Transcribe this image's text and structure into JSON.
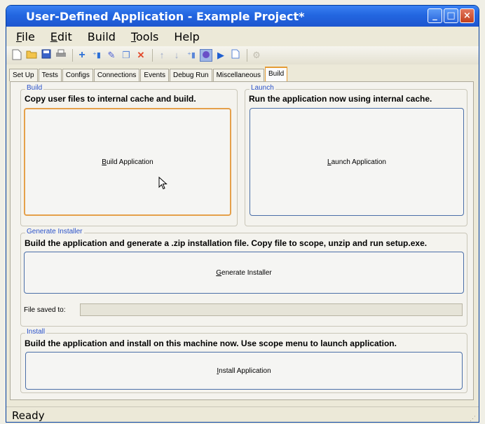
{
  "window": {
    "title": "User-Defined Application - Example Project*"
  },
  "menu": [
    {
      "label": "File",
      "accel": "F"
    },
    {
      "label": "Edit",
      "accel": "E"
    },
    {
      "label": "Build"
    },
    {
      "label": "Tools",
      "accel": "T"
    },
    {
      "label": "Help"
    }
  ],
  "toolbar": [
    "new-icon",
    "open-icon",
    "save-icon",
    "print-icon",
    "add-icon",
    "add-node-icon",
    "edit-icon",
    "copy-icon",
    "delete-icon",
    "move-up-icon",
    "move-down-icon",
    "indent-icon",
    "build-icon",
    "run-icon",
    "page-icon",
    "settings-icon"
  ],
  "tabs": [
    "Set Up",
    "Tests",
    "Configs",
    "Connections",
    "Events",
    "Debug Run",
    "Miscellaneous",
    "Build"
  ],
  "active_tab": "Build",
  "build": {
    "legend": "Build",
    "description": "Copy user files to internal cache and build.",
    "button": "Build Application"
  },
  "launch": {
    "legend": "Launch",
    "description": "Run the application now using internal cache.",
    "button": "Launch Application"
  },
  "installer": {
    "legend": "Generate Installer",
    "description": "Build the application and generate a .zip installation file. Copy file to scope, unzip and run setup.exe.",
    "button": "Generate Installer",
    "file_label": "File saved to:",
    "file_value": ""
  },
  "install": {
    "legend": "Install",
    "description": "Build the application and install on this machine now. Use scope menu to launch application.",
    "button": "Install Application"
  },
  "status": "Ready"
}
